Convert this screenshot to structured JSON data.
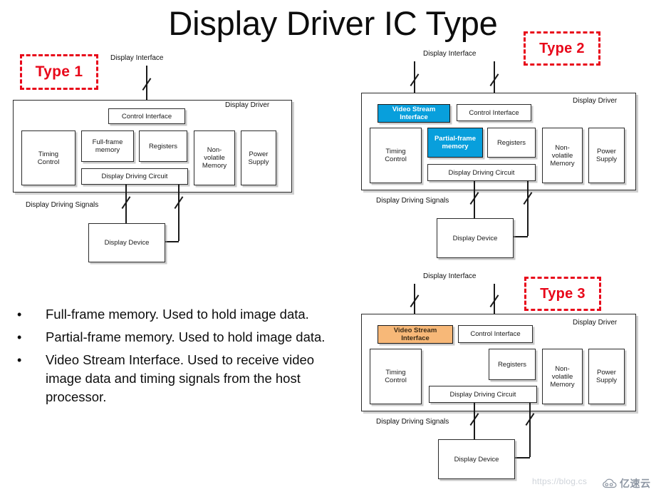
{
  "slide": {
    "title": "Display Driver IC Type",
    "background": "#ffffff",
    "accent_red": "#e8071a",
    "highlight_blue": "#089fdc",
    "highlight_orange": "#f7b878"
  },
  "labels": {
    "display_interface": "Display Interface",
    "display_driver": "Display Driver",
    "display_driving_signals": "Display Driving  Signals",
    "display_device": "Display Device",
    "control_interface": "Control Interface",
    "video_stream_interface": "Video Stream\nInterface",
    "video_stream_interface_l1": "Video Stream",
    "video_stream_interface_l2": "Interface",
    "timing_control_l1": "Timing",
    "timing_control_l2": "Control",
    "full_frame_memory_l1": "Full-frame",
    "full_frame_memory_l2": "memory",
    "partial_frame_memory_l1": "Partial-frame",
    "partial_frame_memory_l2": "memory",
    "registers": "Registers",
    "non_volatile_memory_l1": "Non-",
    "non_volatile_memory_l2": "volatile",
    "non_volatile_memory_l3": "Memory",
    "power_supply_l1": "Power",
    "power_supply_l2": "Supply",
    "display_driving_circuit": "Display Driving Circuit"
  },
  "diagrams": [
    {
      "badge": "Type 1",
      "has_video_stream": false,
      "video_stream_color": "",
      "memory_block": "Full-frame memory",
      "memory_highlight": false
    },
    {
      "badge": "Type 2",
      "has_video_stream": true,
      "video_stream_color": "#089fdc",
      "memory_block": "Partial-frame memory",
      "memory_highlight": true
    },
    {
      "badge": "Type 3",
      "has_video_stream": true,
      "video_stream_color": "#f7b878",
      "memory_block": "",
      "memory_highlight": false
    }
  ],
  "bullets": [
    "Full-frame memory. Used to hold image data.",
    "Partial-frame memory. Used to hold image data.",
    "Video Stream Interface. Used to receive video image data and timing signals from the host processor."
  ],
  "bullet_marker": "•",
  "watermark": {
    "url": "https://blog.cs",
    "brand": "亿速云"
  }
}
